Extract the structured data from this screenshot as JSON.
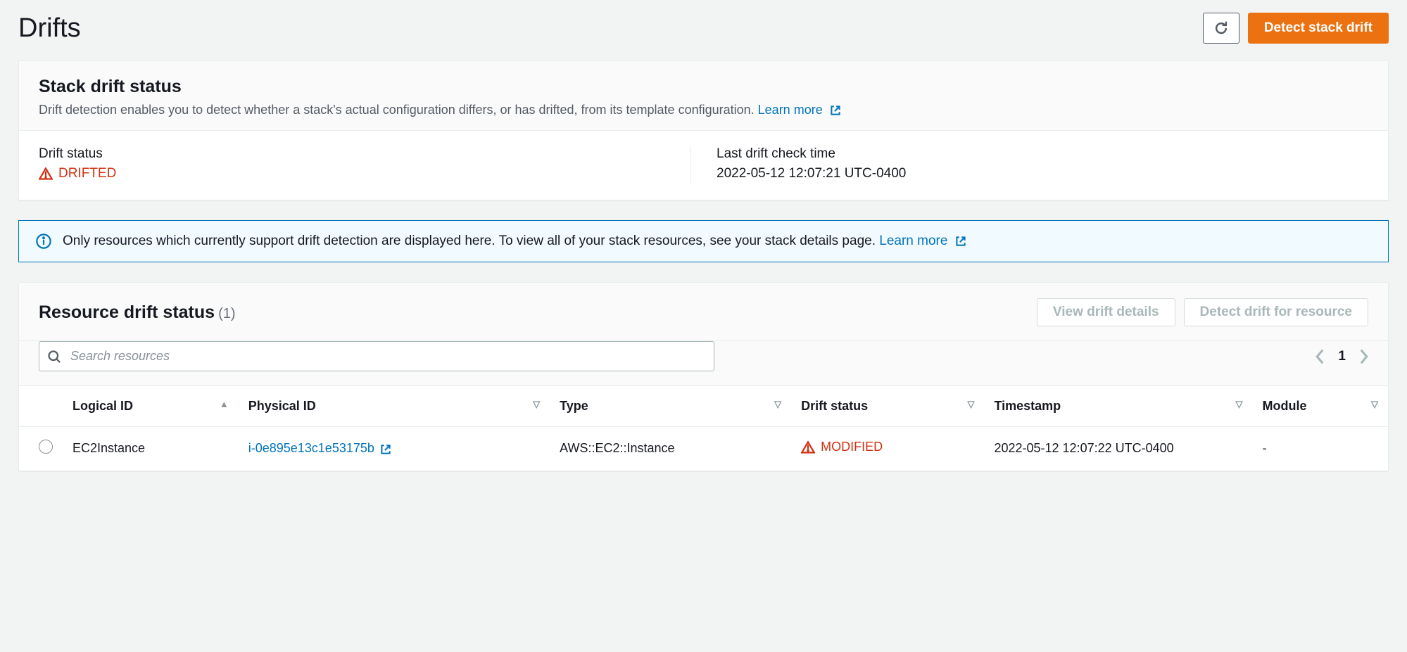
{
  "page": {
    "title": "Drifts",
    "detect_button": "Detect stack drift"
  },
  "stack_drift": {
    "title": "Stack drift status",
    "description": "Drift detection enables you to detect whether a stack's actual configuration differs, or has drifted, from its template configuration.",
    "learn_more": "Learn more",
    "status_label": "Drift status",
    "status_value": "DRIFTED",
    "time_label": "Last drift check time",
    "time_value": "2022-05-12 12:07:21 UTC-0400"
  },
  "info": {
    "text": "Only resources which currently support drift detection are displayed here. To view all of your stack resources, see your stack details page.",
    "learn_more": "Learn more"
  },
  "resource": {
    "title": "Resource drift status",
    "count": "(1)",
    "view_details": "View drift details",
    "detect_resource": "Detect drift for resource",
    "search_placeholder": "Search resources",
    "page_number": "1",
    "columns": {
      "logical_id": "Logical ID",
      "physical_id": "Physical ID",
      "type": "Type",
      "drift_status": "Drift status",
      "timestamp": "Timestamp",
      "module": "Module"
    },
    "rows": [
      {
        "logical_id": "EC2Instance",
        "physical_id": "i-0e895e13c1e53175b",
        "type": "AWS::EC2::Instance",
        "drift_status": "MODIFIED",
        "timestamp": "2022-05-12 12:07:22 UTC-0400",
        "module": "-"
      }
    ]
  }
}
